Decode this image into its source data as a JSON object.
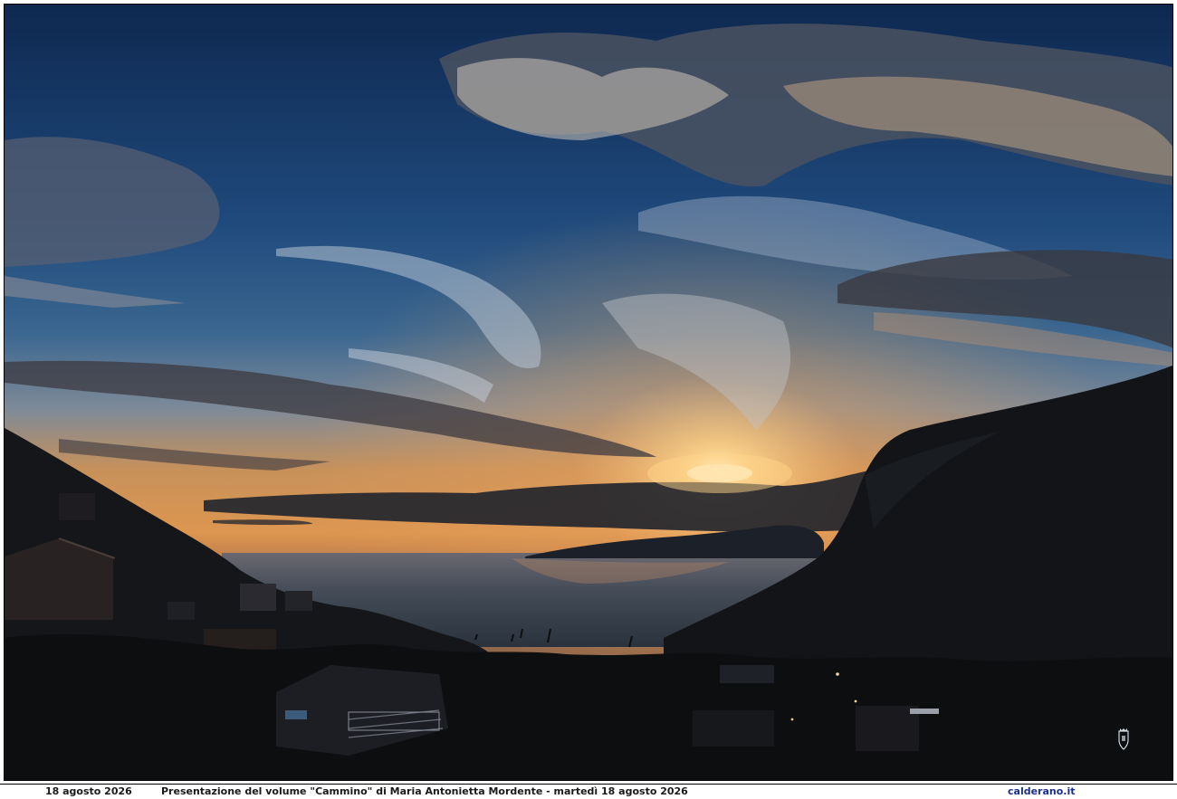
{
  "photo": {
    "subject": "sunset-over-sea-bay",
    "colors": {
      "sky_top": "#12305e",
      "sky_mid": "#2e5a8a",
      "horizon_glow": "#e89a48",
      "sun": "#fff2c8",
      "sea": "#3c4a5a",
      "land": "#0f1116"
    }
  },
  "caption": {
    "date": "18 agosto 2026",
    "title": "Presentazione del volume \"Cammino\" di Maria Antonietta Mordente - martedì 18 agosto 2026",
    "site": "calderano.it"
  },
  "watermark": {
    "icon": "crest-icon"
  }
}
